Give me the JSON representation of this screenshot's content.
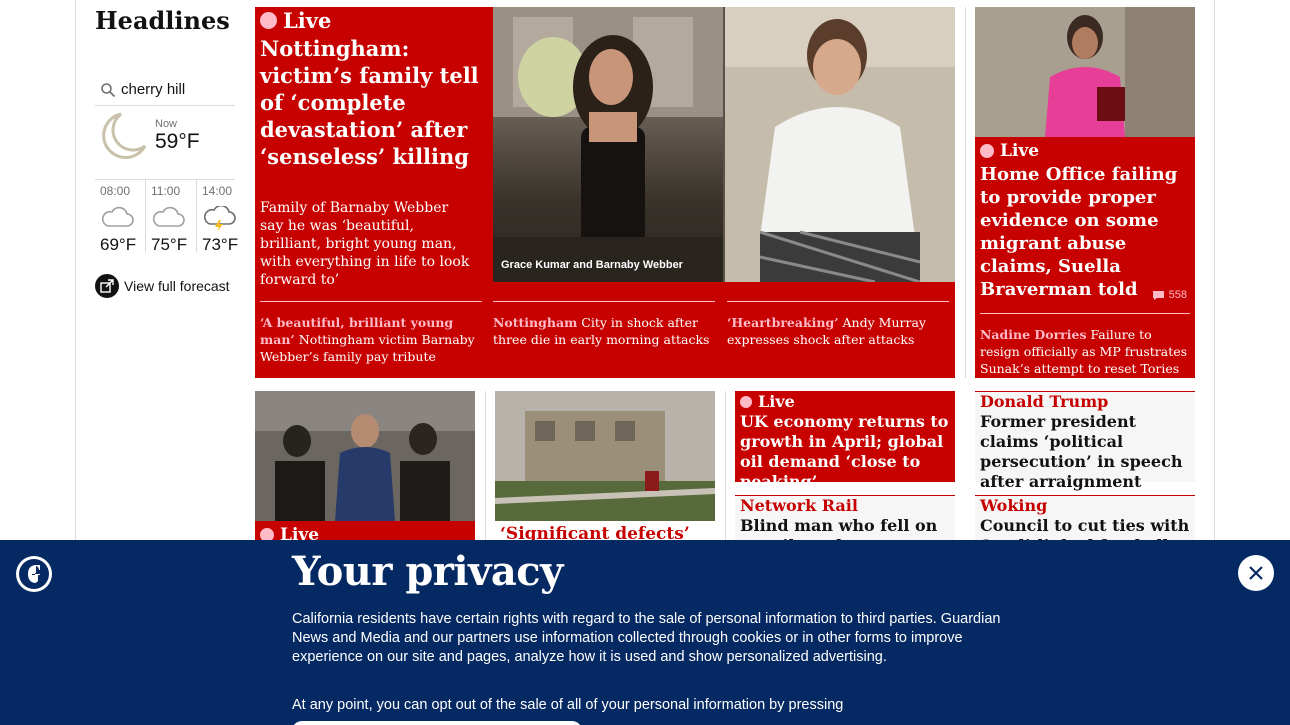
{
  "sidebar": {
    "title": "Headlines",
    "weather": {
      "location": "cherry hill",
      "now_label": "Now",
      "now_temp": "59°F",
      "hours": [
        {
          "time": "08:00",
          "temp": "69°F",
          "icon": "cloud-icon"
        },
        {
          "time": "11:00",
          "temp": "75°F",
          "icon": "cloud-icon"
        },
        {
          "time": "14:00",
          "temp": "73°F",
          "icon": "thunderstorm-icon"
        }
      ],
      "forecast_link": "View full forecast"
    }
  },
  "main_story": {
    "live": "Live",
    "headline": "Nottingham: victim’s family tell of ‘complete devastation’ after ‘senseless’ killing",
    "standfirst": "Family of Barnaby Webber say he was ‘beautiful, brilliant, bright young man, with everything in life to look forward to’",
    "photo_caption": "Grace Kumar and Barnaby Webber",
    "related": [
      {
        "kicker": "‘A beautiful, brilliant young man’",
        "text": "Nottingham victim Barnaby Webber’s family pay tribute"
      },
      {
        "kicker": "Nottingham",
        "text": "City in shock after three die in early morning attacks"
      },
      {
        "kicker": "‘Heartbreaking’",
        "text": "Andy Murray expresses shock after attacks"
      }
    ]
  },
  "right_story": {
    "live": "Live",
    "headline": "Home Office failing to provide proper evidence on some migrant abuse claims, Suella Braverman told",
    "comments": "558",
    "related": {
      "kicker": "Nadine Dorries",
      "text": "Failure to resign officially as MP frustrates Sunak’s attempt to reset Tories"
    }
  },
  "bottom": {
    "b1_live": "Live",
    "b2_kicker": "‘Significant defects’",
    "b3_live": "Live",
    "b3_headline": "UK economy returns to growth in April; global oil demand ‘close to peaking’",
    "b4_kicker": "Network Rail",
    "b4_headline": "Blind man who fell on to rail track was not to blame for",
    "b5_kicker": "Donald Trump",
    "b5_headline": "Former president claims ‘political persecution’ in speech after arraignment",
    "b6_kicker": "Woking",
    "b6_headline": "Council to cut ties with Saudi-linked football club"
  },
  "privacy": {
    "title": "Your privacy",
    "body": "California residents have certain rights with regard to the sale of personal information to third parties. Guardian News and Media and our partners use information collected through cookies or in other forms to improve experience on our site and pages, analyze how it is used and show personalized advertising.",
    "body2": "At any point, you can opt out of the sale of all of your personal information by pressing"
  },
  "colors": {
    "news_red": "#c70000",
    "live_pink": "#ffbac8",
    "brand_blue": "#052962"
  }
}
